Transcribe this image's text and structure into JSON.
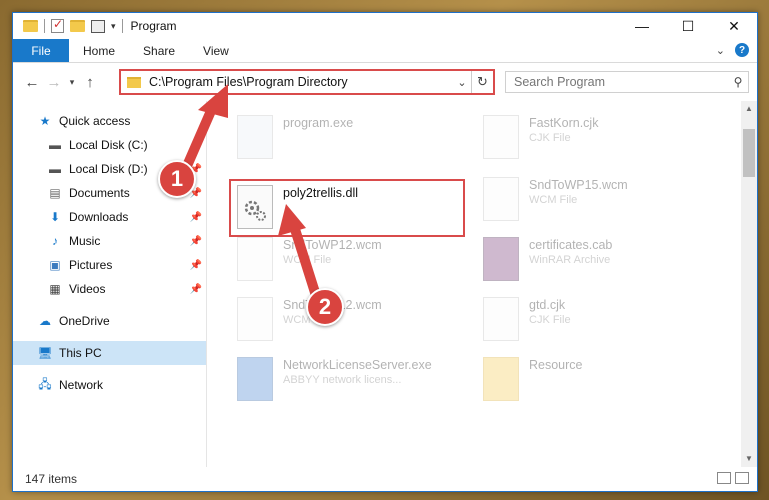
{
  "window": {
    "title": "Program",
    "controls": {
      "minimize": "—",
      "maximize": "☐",
      "close": "✕"
    }
  },
  "ribbon": {
    "tabs": [
      "File",
      "Home",
      "Share",
      "View"
    ]
  },
  "address": {
    "path": "C:\\Program Files\\Program Directory",
    "search_placeholder": "Search Program"
  },
  "sidebar": {
    "items": [
      {
        "label": "Quick access",
        "icon": "star-icon",
        "pinned": false
      },
      {
        "label": "Local Disk (C:)",
        "icon": "drive-icon",
        "pinned": true
      },
      {
        "label": "Local Disk (D:)",
        "icon": "drive-icon",
        "pinned": true
      },
      {
        "label": "Documents",
        "icon": "documents-icon",
        "pinned": true
      },
      {
        "label": "Downloads",
        "icon": "download-icon",
        "pinned": true
      },
      {
        "label": "Music",
        "icon": "music-icon",
        "pinned": true
      },
      {
        "label": "Pictures",
        "icon": "pictures-icon",
        "pinned": true
      },
      {
        "label": "Videos",
        "icon": "videos-icon",
        "pinned": true
      },
      {
        "label": "OneDrive",
        "icon": "cloud-icon",
        "pinned": false
      },
      {
        "label": "This PC",
        "icon": "computer-icon",
        "pinned": false
      },
      {
        "label": "Network",
        "icon": "network-icon",
        "pinned": false
      }
    ]
  },
  "files": {
    "left": [
      {
        "name": "program.exe",
        "type": ""
      },
      {
        "name": "poly2trellis.dll",
        "type": ""
      },
      {
        "name": "SndToWP12.wcm",
        "type": "WCM File"
      },
      {
        "name": "SndToWP12.wcm",
        "type": "WCM File"
      },
      {
        "name": "NetworkLicenseServer.exe",
        "type": "ABBYY network licens..."
      }
    ],
    "right": [
      {
        "name": "FastKorn.cjk",
        "type": "CJK File"
      },
      {
        "name": "SndToWP15.wcm",
        "type": "WCM File"
      },
      {
        "name": "certificates.cab",
        "type": "WinRAR Archive"
      },
      {
        "name": "gtd.cjk",
        "type": "CJK File"
      },
      {
        "name": "Resource",
        "type": ""
      }
    ]
  },
  "callouts": [
    "1",
    "2"
  ],
  "status": {
    "item_count": "147 items"
  },
  "colors": {
    "accent": "#1979ca",
    "highlight": "#d94b4b",
    "selection": "#cce4f7"
  }
}
